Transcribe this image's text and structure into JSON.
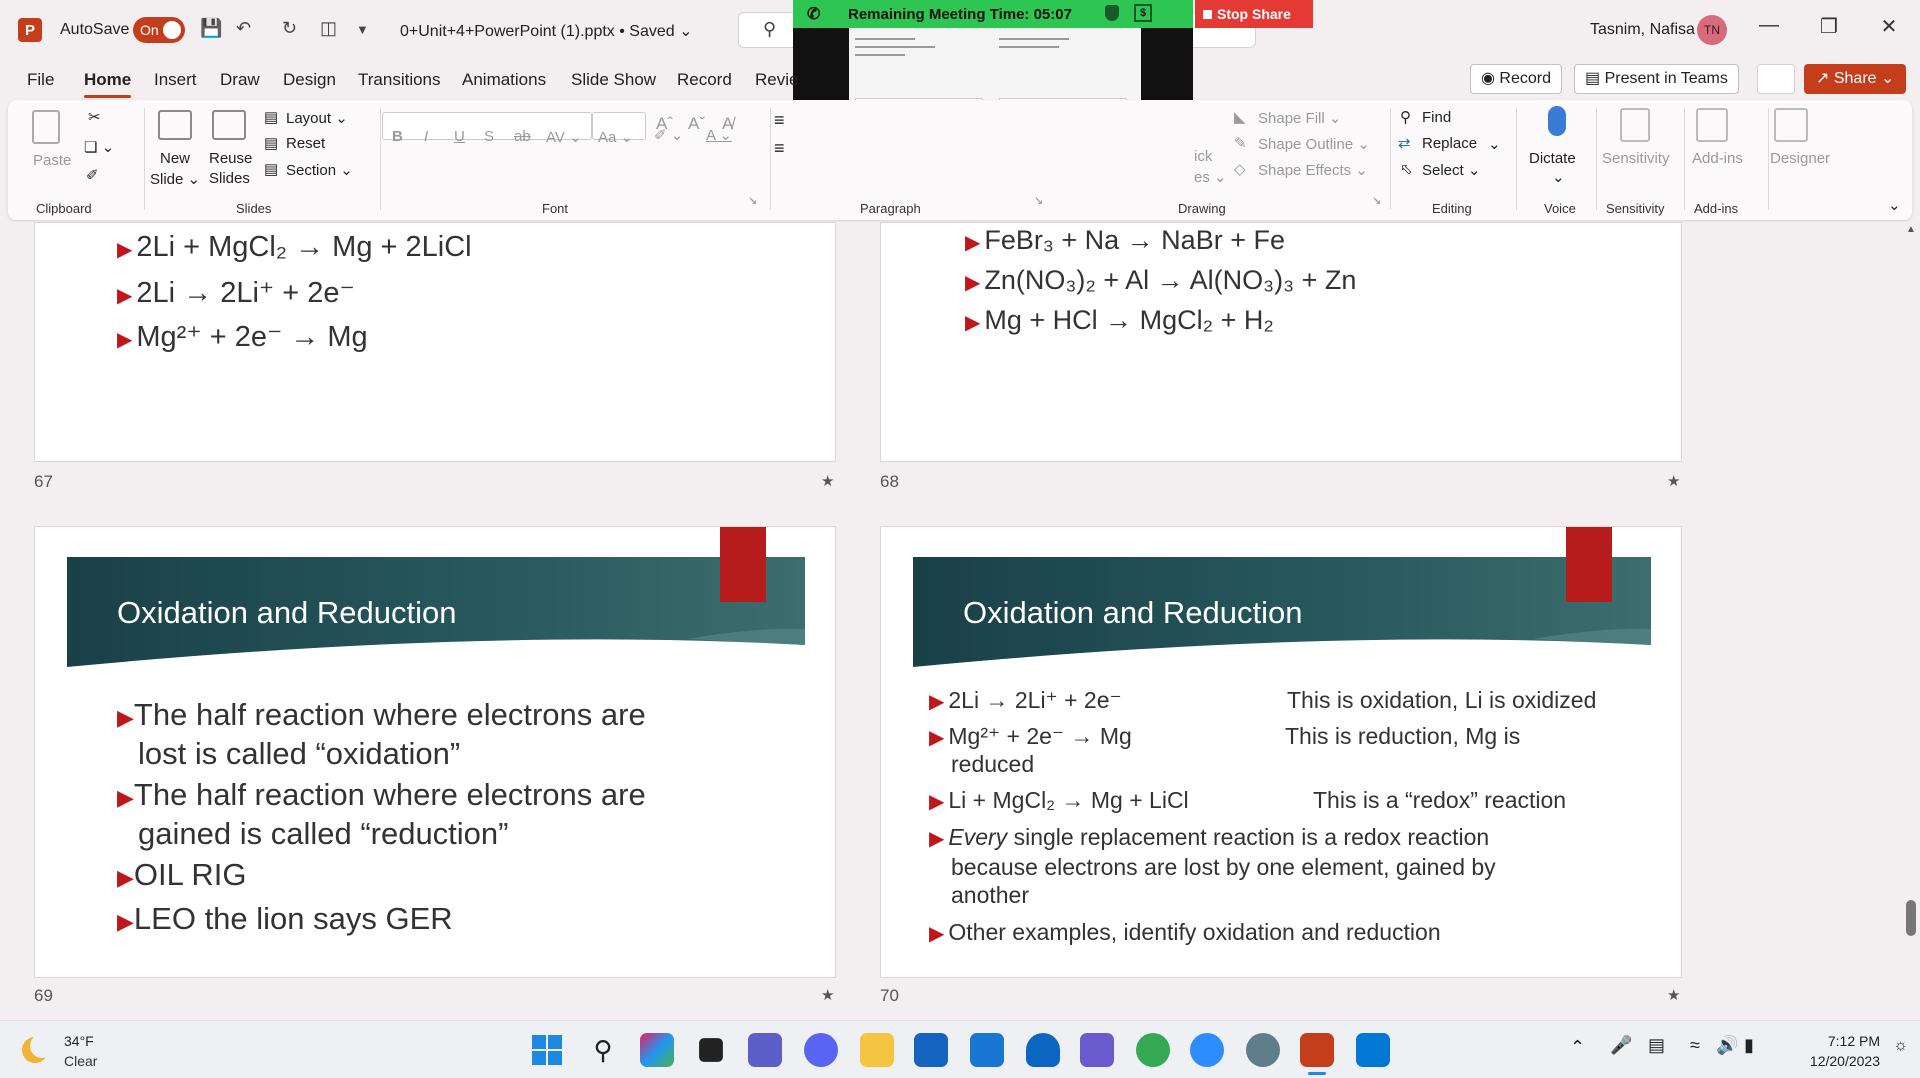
{
  "titlebar": {
    "autosave_label": "AutoSave",
    "autosave_state": "On",
    "filename": "0+Unit+4+PowerPoint (1).pptx • Saved ⌄",
    "user_name": "Tasnim, Nafisa",
    "user_initials": "TN"
  },
  "meeting": {
    "remaining_label": "Remaining Meeting Time: 05:07",
    "stop_share": "Stop Share"
  },
  "actions": {
    "record": "Record",
    "present_teams": "Present in Teams",
    "share": "Share"
  },
  "tabs": [
    "File",
    "Home",
    "Insert",
    "Draw",
    "Design",
    "Transitions",
    "Animations",
    "Slide Show",
    "Record",
    "Revie"
  ],
  "active_tab": "Home",
  "ribbon": {
    "clipboard": {
      "paste": "Paste",
      "label": "Clipboard"
    },
    "slides": {
      "new_slide": "New",
      "new_slide2": "Slide ⌄",
      "reuse": "Reuse",
      "reuse2": "Slides",
      "layout": "Layout ⌄",
      "reset": "Reset",
      "section": "Section ⌄",
      "label": "Slides"
    },
    "font": {
      "label": "Font"
    },
    "paragraph": {
      "label": "Paragraph"
    },
    "drawing": {
      "shape_fill": "Shape Fill ⌄",
      "shape_outline": "Shape Outline ⌄",
      "shape_effects": "Shape Effects ⌄",
      "quick1": "ick",
      "quick2": "es ⌄",
      "label": "Drawing"
    },
    "editing": {
      "find": "Find",
      "replace": "Replace",
      "select": "Select ⌄",
      "label": "Editing"
    },
    "voice": {
      "dictate": "Dictate",
      "label": "Voice"
    },
    "sensitivity": {
      "btn": "Sensitivity",
      "label": "Sensitivity"
    },
    "addins": {
      "btn": "Add-ins",
      "label": "Add-ins"
    },
    "designer": {
      "btn": "Designer"
    }
  },
  "slides": {
    "s67": {
      "number": "67",
      "lines": [
        "2Li + MgCl₂ → Mg + 2LiCl",
        "2Li →  2Li⁺ + 2e⁻",
        "Mg²⁺ + 2e⁻ → Mg"
      ]
    },
    "s68": {
      "number": "68",
      "lines": [
        "FeBr₃ + Na → NaBr + Fe",
        "Zn(NO₃)₂ + Al → Al(NO₃)₃ + Zn",
        "Mg + HCl → MgCl₂ + H₂"
      ]
    },
    "s69": {
      "number": "69",
      "title": "Oxidation and Reduction",
      "b1a": "The half reaction where electrons are",
      "b1b": "lost is called “oxidation”",
      "b2a": "The half reaction where electrons are",
      "b2b": "gained is called “reduction”",
      "b3": "OIL RIG",
      "b4": "LEO the lion says GER"
    },
    "s70": {
      "number": "70",
      "title": "Oxidation and Reduction",
      "r1": "2Li →  2Li⁺ + 2e⁻",
      "r1_note": "This is oxidation, Li is oxidized",
      "r2": "Mg²⁺ + 2e⁻ → Mg",
      "r2_note": "This is reduction, Mg is",
      "r2_cont": "reduced",
      "r3": "Li + MgCl₂ → Mg + LiCl",
      "r3_note": "This is a “redox” reaction",
      "r4_em": "Every",
      "r4a": " single replacement reaction is a redox reaction",
      "r4b": "because electrons are lost by one element, gained by",
      "r4c": "another",
      "r5": "Other examples, identify oxidation and reduction"
    }
  },
  "taskbar": {
    "temp": "34°F",
    "condition": "Clear",
    "time": "7:12 PM",
    "date": "12/20/2023"
  }
}
